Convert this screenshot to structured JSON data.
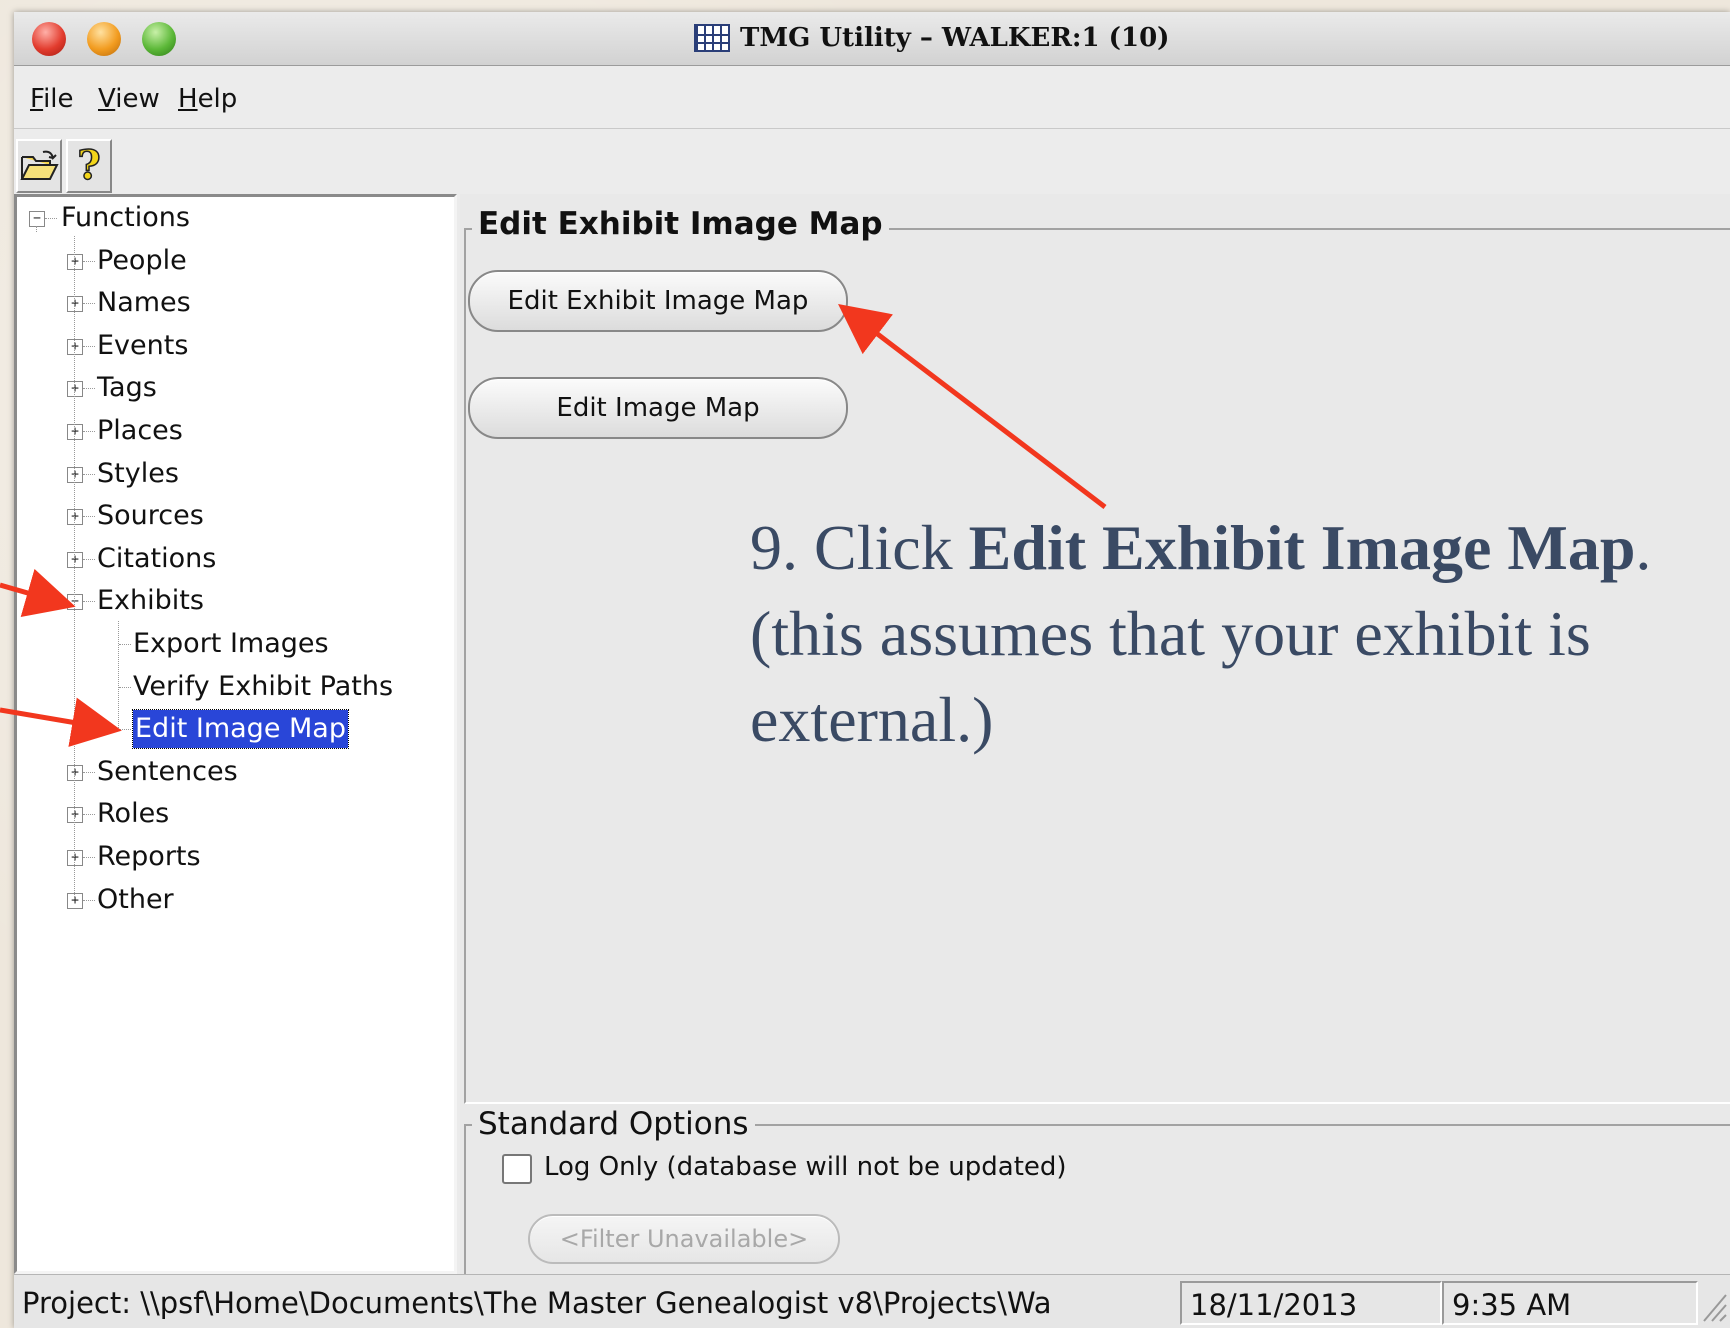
{
  "window": {
    "title": "TMG Utility – WALKER:1 (10)"
  },
  "menu": {
    "items": [
      "File",
      "View",
      "Help"
    ]
  },
  "toolbar": {
    "buttons": [
      "open-folder-icon",
      "help-icon"
    ]
  },
  "tree": {
    "root": "Functions",
    "items": [
      {
        "label": "People",
        "state": "collapsed"
      },
      {
        "label": "Names",
        "state": "collapsed"
      },
      {
        "label": "Events",
        "state": "collapsed"
      },
      {
        "label": "Tags",
        "state": "collapsed"
      },
      {
        "label": "Places",
        "state": "collapsed"
      },
      {
        "label": "Styles",
        "state": "collapsed"
      },
      {
        "label": "Sources",
        "state": "collapsed"
      },
      {
        "label": "Citations",
        "state": "collapsed"
      },
      {
        "label": "Exhibits",
        "state": "expanded"
      },
      {
        "label": "Sentences",
        "state": "collapsed"
      },
      {
        "label": "Roles",
        "state": "collapsed"
      },
      {
        "label": "Reports",
        "state": "collapsed"
      },
      {
        "label": "Other",
        "state": "collapsed"
      }
    ],
    "exhibit_children": [
      "Export Images",
      "Verify Exhibit Paths",
      "Edit Image Map"
    ],
    "selected": "Edit Image Map"
  },
  "main": {
    "group_title": "Edit Exhibit Image Map",
    "button_exhibit": "Edit Exhibit Image Map",
    "button_image": "Edit Image Map",
    "options_title": "Standard Options",
    "log_only_label": "Log Only (database will not be updated)",
    "log_only_checked": false,
    "filter_button": "<Filter Unavailable>"
  },
  "status": {
    "project": "Project: \\\\psf\\Home\\Documents\\The Master Genealogist v8\\Projects\\Wa",
    "date": "18/11/2013",
    "time": "9:35 AM"
  },
  "annotation": {
    "prefix": "9.  Click ",
    "bold": "Edit Exhibit Image Map",
    "suffix": ".",
    "line2": "(this assumes that your exhibit is",
    "line3": "external.)"
  },
  "colors": {
    "selection": "#2946d8",
    "arrow": "#f2371e",
    "annotation_text": "#3a4a64"
  }
}
